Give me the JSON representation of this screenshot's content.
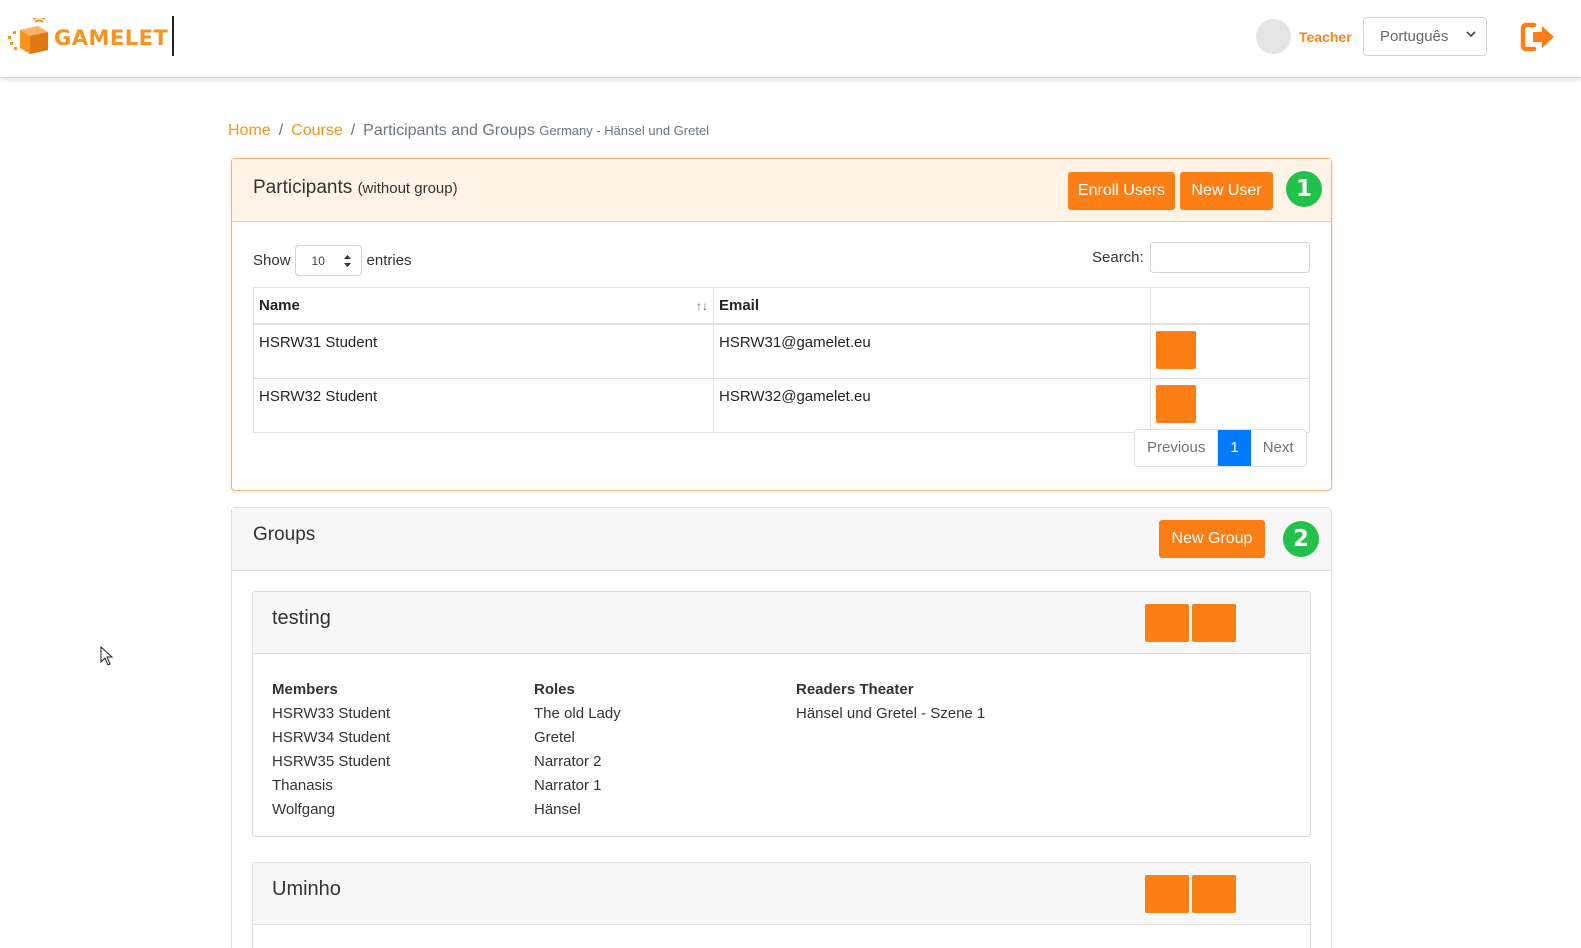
{
  "header": {
    "brand": "GAMELET",
    "user_name": "Teacher",
    "language": "Português",
    "icons": {
      "logout": "logout-icon",
      "language_chevron": "chevron-down-icon"
    }
  },
  "breadcrumb": {
    "home": "Home",
    "course": "Course",
    "current": "Participants and Groups",
    "subtitle": "Germany - Hänsel und Gretel"
  },
  "participants": {
    "title": "Participants",
    "title_note": "(without group)",
    "enroll_label": "Enroll Users",
    "new_user_label": "New User",
    "badge": "1",
    "show_label": "Show",
    "entries_value": "10",
    "entries_label": "entries",
    "search_label": "Search:",
    "search_value": "",
    "columns": [
      "Name",
      "Email",
      ""
    ],
    "rows": [
      {
        "name": "HSRW31 Student",
        "email": "HSRW31@gamelet.eu"
      },
      {
        "name": "HSRW32 Student",
        "email": "HSRW32@gamelet.eu"
      }
    ],
    "pager": {
      "previous": "Previous",
      "page": "1",
      "next": "Next"
    }
  },
  "groups": {
    "title": "Groups",
    "new_group_label": "New Group",
    "badge": "2",
    "items": [
      {
        "name": "testing",
        "members_header": "Members",
        "members": [
          "HSRW33 Student",
          "HSRW34 Student",
          "HSRW35 Student",
          "Thanasis",
          "Wolfgang"
        ],
        "roles_header": "Roles",
        "roles": [
          "The old Lady",
          "Gretel",
          "Narrator 2",
          "Narrator 1",
          "Hänsel"
        ],
        "theater_header": "Readers Theater",
        "theater": [
          "Hänsel und Gretel - Szene 1"
        ]
      },
      {
        "name": "Uminho"
      }
    ]
  },
  "colors": {
    "brand_orange": "#fd7e14",
    "badge_green": "#22c24a",
    "pager_active": "#007bff"
  }
}
